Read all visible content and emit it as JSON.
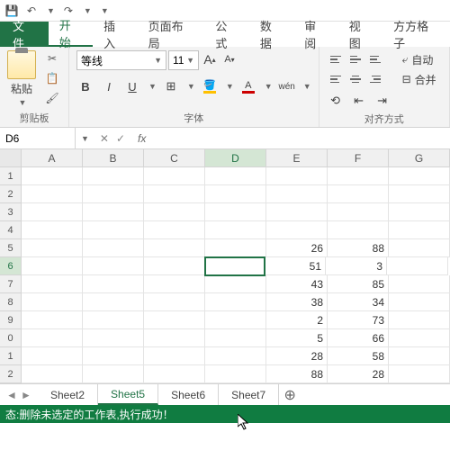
{
  "qat": {
    "save": "💾",
    "undo": "↶",
    "redo": "↷"
  },
  "menu": {
    "file": "文件",
    "tabs": [
      "开始",
      "插入",
      "页面布局",
      "公式",
      "数据",
      "审阅",
      "视图",
      "方方格子"
    ],
    "active": 0
  },
  "ribbon": {
    "clipboard": {
      "paste": "粘贴",
      "label": "剪贴板"
    },
    "font": {
      "family": "等线",
      "size": "11",
      "bold": "B",
      "italic": "I",
      "underline": "U",
      "increase": "A",
      "decrease": "A",
      "wen": "wén",
      "label": "字体"
    },
    "align": {
      "wrap": "自动",
      "merge": "合并",
      "label": "对齐方式"
    }
  },
  "namebox": {
    "ref": "D6",
    "fx": "fx"
  },
  "columns": [
    "A",
    "B",
    "C",
    "D",
    "E",
    "F",
    "G"
  ],
  "rows": [
    {
      "n": 1,
      "cells": [
        "",
        "",
        "",
        "",
        "",
        "",
        ""
      ]
    },
    {
      "n": 2,
      "cells": [
        "",
        "",
        "",
        "",
        "",
        "",
        ""
      ]
    },
    {
      "n": 3,
      "cells": [
        "",
        "",
        "",
        "",
        "",
        "",
        ""
      ]
    },
    {
      "n": 4,
      "cells": [
        "",
        "",
        "",
        "",
        "",
        "",
        ""
      ]
    },
    {
      "n": 5,
      "cells": [
        "",
        "",
        "",
        "",
        "26",
        "88",
        ""
      ]
    },
    {
      "n": 6,
      "cells": [
        "",
        "",
        "",
        "",
        "51",
        "3",
        ""
      ]
    },
    {
      "n": 7,
      "cells": [
        "",
        "",
        "",
        "",
        "43",
        "85",
        ""
      ]
    },
    {
      "n": 8,
      "cells": [
        "",
        "",
        "",
        "",
        "38",
        "34",
        ""
      ]
    },
    {
      "n": 9,
      "cells": [
        "",
        "",
        "",
        "",
        "2",
        "73",
        ""
      ]
    },
    {
      "n": 0,
      "cells": [
        "",
        "",
        "",
        "",
        "5",
        "66",
        ""
      ]
    },
    {
      "n": 1,
      "cells": [
        "",
        "",
        "",
        "",
        "28",
        "58",
        ""
      ]
    },
    {
      "n": 2,
      "cells": [
        "",
        "",
        "",
        "",
        "88",
        "28",
        ""
      ]
    }
  ],
  "activeCell": {
    "row": 5,
    "col": 3
  },
  "sheets": {
    "tabs": [
      "Sheet2",
      "Sheet5",
      "Sheet6",
      "Sheet7"
    ],
    "active": 1
  },
  "status": "态:删除未选定的工作表,执行成功！"
}
